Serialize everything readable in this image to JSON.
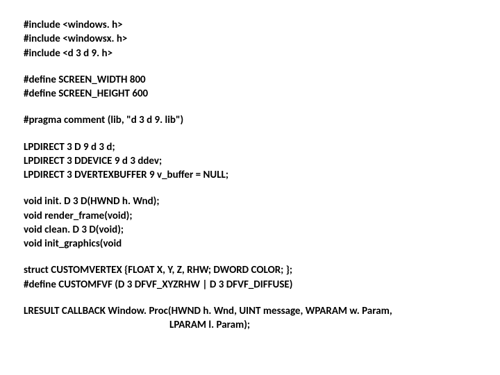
{
  "block1": {
    "l1": "#include <windows. h>",
    "l2": "#include <windowsx. h>",
    "l3": "#include <d 3 d 9. h>"
  },
  "block2": {
    "l1": "#define SCREEN_WIDTH 800",
    "l2": "#define SCREEN_HEIGHT 600"
  },
  "block3": {
    "l1": "#pragma comment (lib, \"d 3 d 9. lib\")"
  },
  "block4": {
    "l1": "LPDIRECT 3 D 9 d 3 d;",
    "l2": "LPDIRECT 3 DDEVICE 9 d 3 ddev;",
    "l3": "LPDIRECT 3 DVERTEXBUFFER 9 v_buffer = NULL;"
  },
  "block5": {
    "l1": "void init. D 3 D(HWND h. Wnd);",
    "l2": "void render_frame(void);",
    "l3": "void clean. D 3 D(void);",
    "l4": "void init_graphics(void"
  },
  "block6": {
    "l1": "struct CUSTOMVERTEX {FLOAT X, Y, Z, RHW; DWORD COLOR; };",
    "l2": "#define CUSTOMFVF (D 3 DFVF_XYZRHW | D 3 DFVF_DIFFUSE)"
  },
  "block7": {
    "l1": "LRESULT CALLBACK Window. Proc(HWND h. Wnd, UINT message, WPARAM w. Param,",
    "l2": "LPARAM l. Param);"
  },
  "chart_data": {
    "type": "table",
    "title": "C++ DirectX code snippet",
    "lines": [
      "#include <windows. h>",
      "#include <windowsx. h>",
      "#include <d 3 d 9. h>",
      "",
      "#define SCREEN_WIDTH 800",
      "#define SCREEN_HEIGHT 600",
      "",
      "#pragma comment (lib, \"d 3 d 9. lib\")",
      "",
      "LPDIRECT 3 D 9 d 3 d;",
      "LPDIRECT 3 DDEVICE 9 d 3 ddev;",
      "LPDIRECT 3 DVERTEXBUFFER 9 v_buffer = NULL;",
      "",
      "void init. D 3 D(HWND h. Wnd);",
      "void render_frame(void);",
      "void clean. D 3 D(void);",
      "void init_graphics(void",
      "",
      "struct CUSTOMVERTEX {FLOAT X, Y, Z, RHW; DWORD COLOR; };",
      "#define CUSTOMFVF (D 3 DFVF_XYZRHW | D 3 DFVF_DIFFUSE)",
      "",
      "LRESULT CALLBACK Window. Proc(HWND h. Wnd, UINT message, WPARAM w. Param,",
      "LPARAM l. Param);"
    ]
  }
}
